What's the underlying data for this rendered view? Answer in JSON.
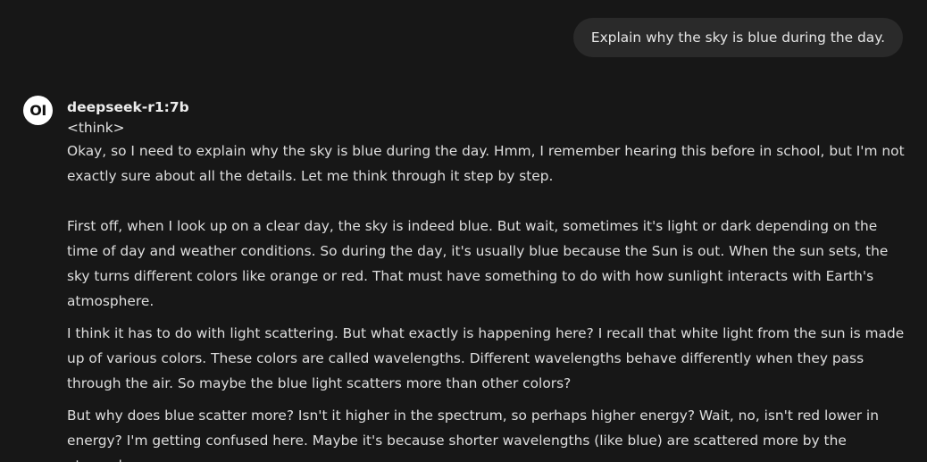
{
  "user_message": {
    "text": "Explain why the sky is blue during the day."
  },
  "assistant": {
    "avatar_text": "OI",
    "model_name": "deepseek-r1:7b",
    "think_tag": "<think>",
    "paragraphs": [
      "Okay, so I need to explain why the sky is blue during the day. Hmm, I remember hearing this before in school, but I'm not exactly sure about all the details. Let me think through it step by step.",
      "First off, when I look up on a clear day, the sky is indeed blue. But wait, sometimes it's light or dark depending on the time of day and weather conditions. So during the day, it's usually blue because the Sun is out. When the sun sets, the sky turns different colors like orange or red. That must have something to do with how sunlight interacts with Earth's atmosphere.",
      "I think it has to do with light scattering. But what exactly is happening here? I recall that white light from the sun is made up of various colors. These colors are called wavelengths. Different wavelengths behave differently when they pass through the air. So maybe the blue light scatters more than other colors?",
      "But why does blue scatter more? Isn't it higher in the spectrum, so perhaps higher energy? Wait, no, isn't red lower in energy? I'm getting confused here. Maybe it's because shorter wavelengths (like blue) are scattered more by the atmosphere."
    ]
  },
  "colors": {
    "background": "#171717",
    "user_bubble": "#2a2a2a",
    "text": "#e3e3e3"
  }
}
